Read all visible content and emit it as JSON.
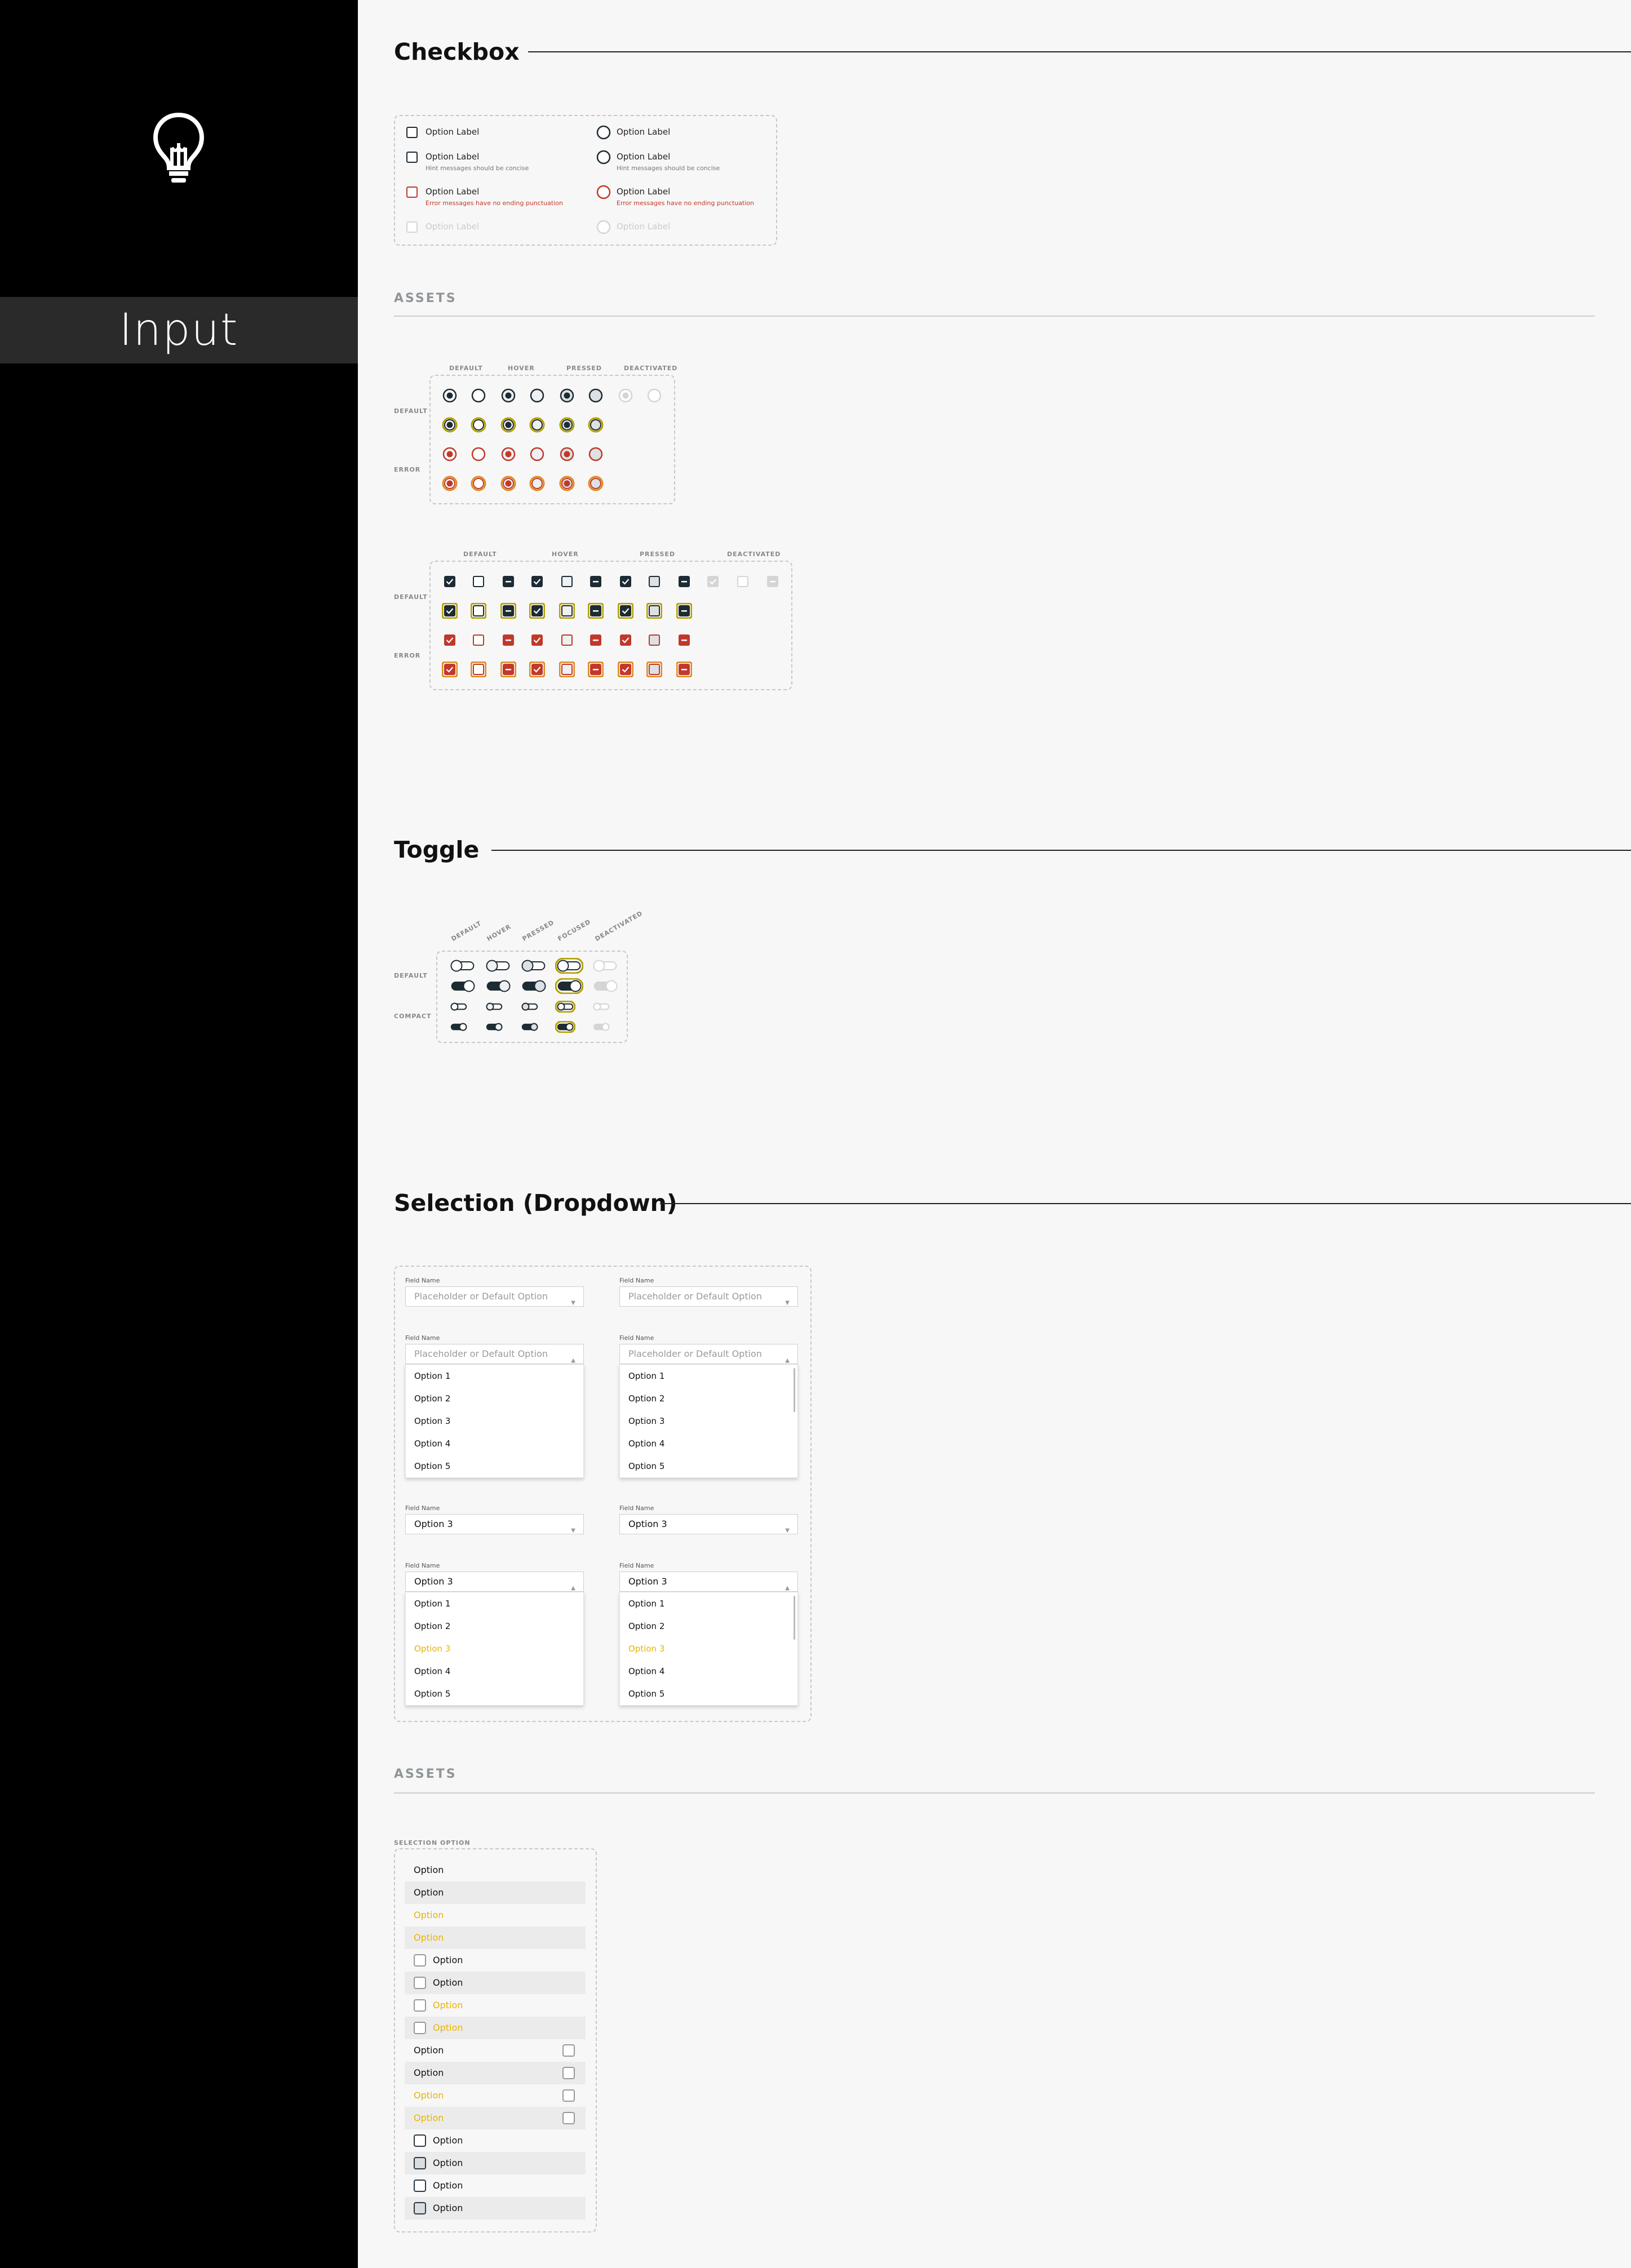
{
  "sidebar": {
    "section_title": "Input",
    "logo_icon": "lightbulb-icon"
  },
  "checkbox": {
    "title": "Checkbox",
    "examples": {
      "option_label": "Option Label",
      "hint": "Hint messages should be concise",
      "error": "Error messages have no ending punctuation"
    },
    "assets_label": "ASSETS",
    "radio_grid": {
      "columns": [
        "DEFAULT",
        "HOVER",
        "PRESSED",
        "DEACTIVATED"
      ],
      "rows": [
        "DEFAULT",
        "ERROR"
      ]
    },
    "checkbox_grid": {
      "columns": [
        "DEFAULT",
        "HOVER",
        "PRESSED",
        "DEACTIVATED"
      ],
      "rows": [
        "DEFAULT",
        "ERROR"
      ]
    }
  },
  "toggle": {
    "title": "Toggle",
    "columns": [
      "DEFAULT",
      "HOVER",
      "PRESSED",
      "FOCUSED",
      "DEACTIVATED"
    ],
    "rows": [
      "DEFAULT",
      "COMPACT"
    ]
  },
  "selection": {
    "title": "Selection (Dropdown)",
    "field_name": "Field Name",
    "placeholder": "Placeholder or Default Option",
    "selected_value": "Option 3",
    "options": [
      "Option 1",
      "Option 2",
      "Option 3",
      "Option 4",
      "Option 5"
    ],
    "assets_label": "ASSETS",
    "selection_option_label": "SELECTION OPTION",
    "option_text": "Option"
  },
  "colors": {
    "dark": "#1d2b33",
    "error": "#c0392b",
    "focus": "#e8b400",
    "disabled": "#d5d5d5"
  }
}
